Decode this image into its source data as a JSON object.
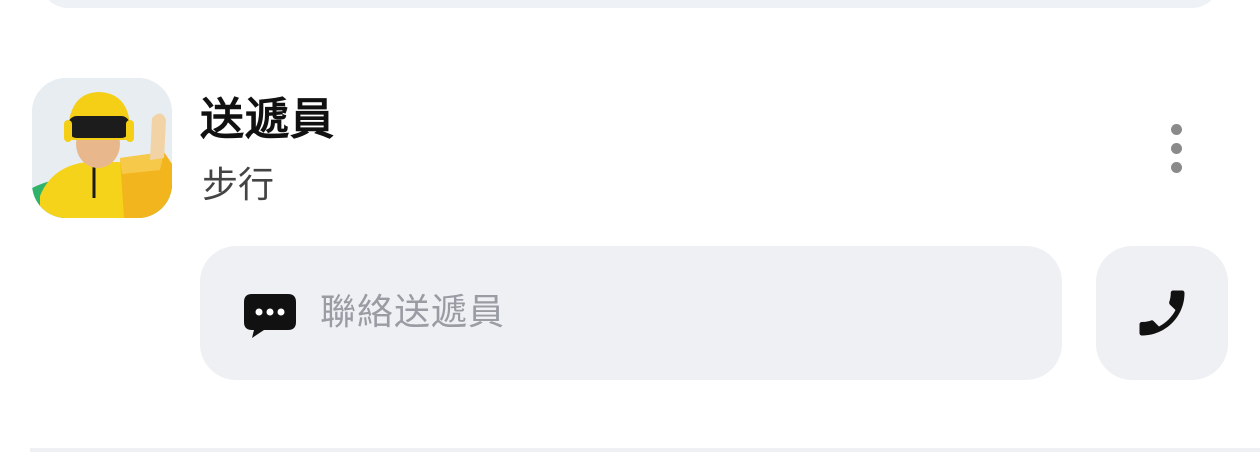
{
  "courier": {
    "name": "送遞員",
    "status": "步行",
    "avatar_icon": "delivery-rider-avatar"
  },
  "actions": {
    "more_icon": "more-vertical-icon",
    "contact_label": "聯絡送遞員",
    "contact_icon": "chat-bubble-icon",
    "call_icon": "phone-icon"
  },
  "colors": {
    "button_bg": "#eff0f4",
    "placeholder_text": "#9a9ca4",
    "name_text": "#111111",
    "status_text": "#444444",
    "dots": "#8a8a8a"
  }
}
